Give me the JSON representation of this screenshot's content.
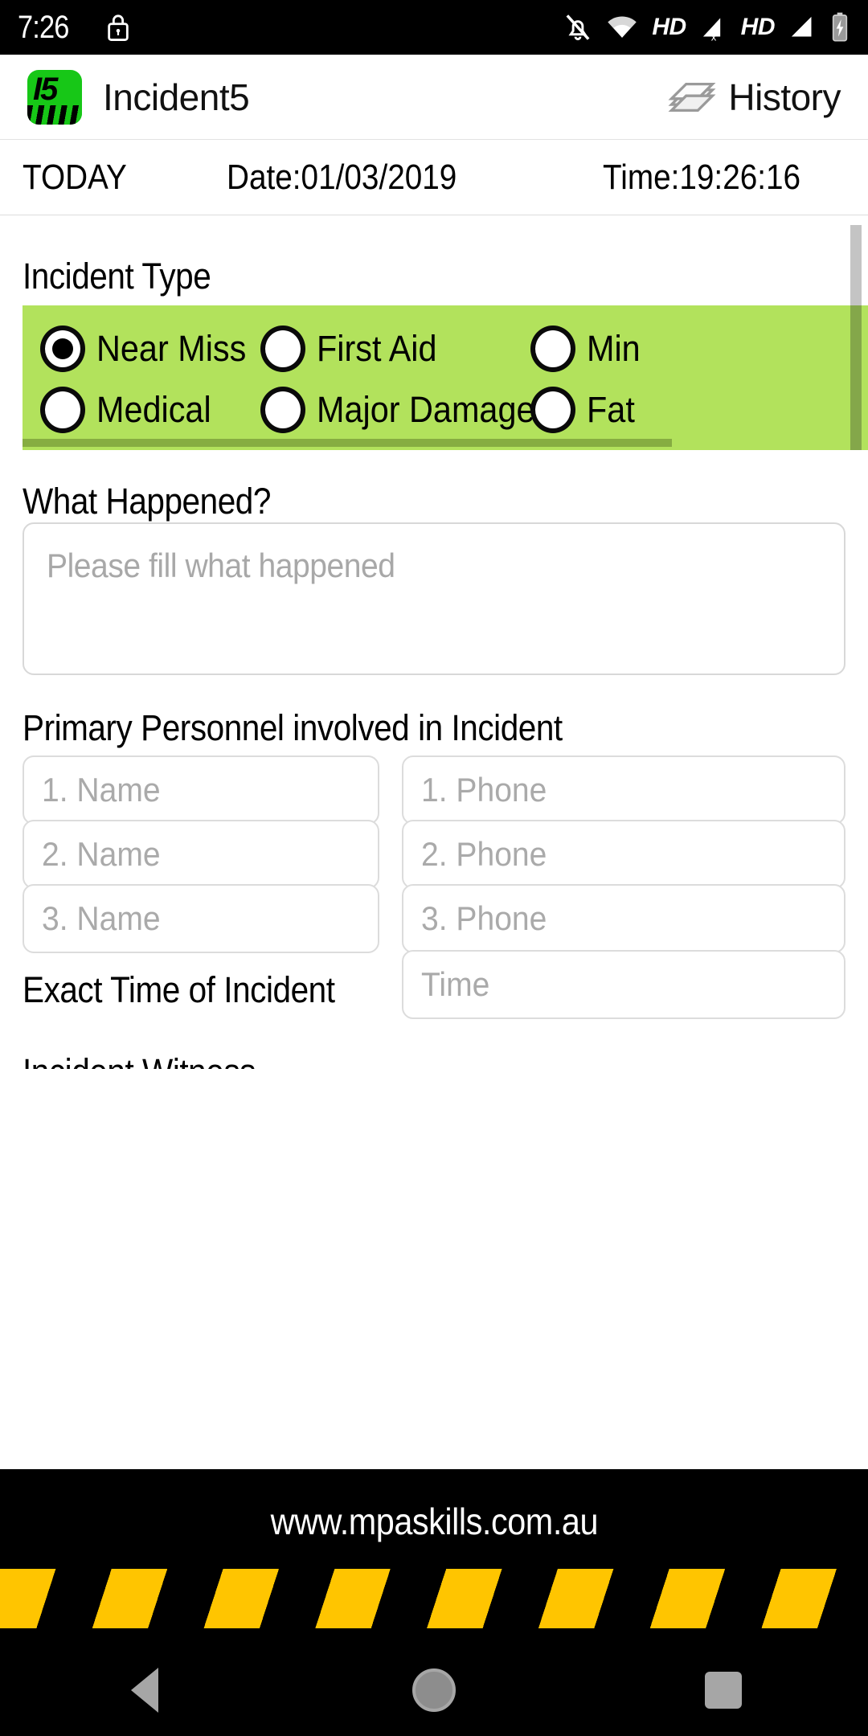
{
  "status_bar": {
    "time": "7:26",
    "icons": [
      "lock-icon",
      "notifications-off-icon",
      "wifi-icon",
      "hd-badge",
      "signal-no-sim-icon",
      "hd-badge-2",
      "signal-bars-icon",
      "battery-charging-icon"
    ],
    "hd_label": "HD",
    "hd_label_2": "HD"
  },
  "app_bar": {
    "logo_text": "I5",
    "title": "Incident5",
    "history_label": "History",
    "history_icon": "layers-stack-icon"
  },
  "date_row": {
    "today_label": "TODAY",
    "date": "Date:01/03/2019",
    "time": "Time:19:26:16"
  },
  "form": {
    "incident_type": {
      "heading": "Incident Type",
      "panel_color": "#b2e25c",
      "options": [
        {
          "label": "Near Miss",
          "selected": true
        },
        {
          "label": "First Aid",
          "selected": false
        },
        {
          "label": "Min",
          "selected": false
        },
        {
          "label": "Medical",
          "selected": false
        },
        {
          "label": "Major Damage",
          "selected": false
        },
        {
          "label": "Fat",
          "selected": false
        }
      ]
    },
    "what_happened": {
      "heading": "What Happened?",
      "placeholder": "Please fill what happened",
      "value": ""
    },
    "primary_personnel": {
      "heading": "Primary Personnel involved in Incident",
      "rows": [
        {
          "name_placeholder": "1. Name",
          "name_value": "",
          "phone_placeholder": "1. Phone",
          "phone_value": ""
        },
        {
          "name_placeholder": "2. Name",
          "name_value": "",
          "phone_placeholder": "2. Phone",
          "phone_value": ""
        },
        {
          "name_placeholder": "3. Name",
          "name_value": "",
          "phone_placeholder": "3. Phone",
          "phone_value": ""
        }
      ]
    },
    "exact_time": {
      "heading": "Exact Time of Incident",
      "placeholder": "Time",
      "value": ""
    },
    "next_section_partial": "Incident Witness"
  },
  "footer": {
    "url": "www.mpaskills.com.au",
    "hazard_color": "#ffc500"
  },
  "nav_bar": {
    "back": "back-icon",
    "home": "home-icon",
    "recents": "recents-icon"
  }
}
